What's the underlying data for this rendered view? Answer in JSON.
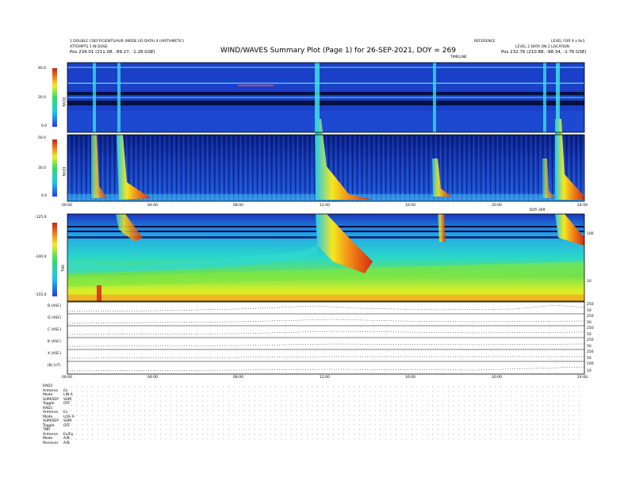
{
  "header": {
    "title": "WIND/WAVES Summary Plot (Page 1) for 26-SEP-2021, DOY = 269",
    "left_line1": "1 DOUBLE COEFFICIENTS/AUR (MODE I/O DATA) 4 (ARITHMETIC)",
    "left_line2": "ATTEMPTS 1 IN DOSE",
    "left_line3": "Pos   234.01 (211.08, -89.27, -1.28 GSE)",
    "right_line1": "REFERENCE",
    "right_line2": "LEVEL 2 DATA ON 2 LOCATION",
    "right_line3": "Pos   232.76 (210.88, -98.34, -1.76 GSE)",
    "right_top_small": "LEVEL FOR 9 x 9x1",
    "center_small": "TIMELINE"
  },
  "panels": {
    "rad2": {
      "label": "RAD2",
      "ticks": [
        "40.0",
        "20.0",
        "0.0"
      ]
    },
    "rad1": {
      "label": "RAD1",
      "ticks": [
        "50.0",
        "30.0",
        "0.0"
      ]
    },
    "tnr": {
      "label": "TNR",
      "ticks": [
        "-125.0",
        "-140.0",
        "-155.0"
      ],
      "right_ticks": [
        "100",
        "10"
      ]
    }
  },
  "time_ticks_a": [
    "00:00",
    "04:00",
    "08:00",
    "12:00",
    "16:00",
    "20:00",
    "24:00"
  ],
  "time_ticks_b": [
    "00:00",
    "04:00",
    "08:00",
    "12:00",
    "16:00",
    "20:00",
    "24:00"
  ],
  "mid_marker": "DOY 269",
  "line_panels": [
    {
      "label": "B (ASC)",
      "right_ticks": [
        "250",
        "50"
      ]
    },
    {
      "label": "Q (ASC)",
      "right_ticks": [
        "250",
        "50"
      ]
    },
    {
      "label": "C (ASC)",
      "right_ticks": [
        "250",
        "50"
      ]
    },
    {
      "label": "K (ASC)",
      "right_ticks": [
        "250",
        "50"
      ]
    },
    {
      "label": "X (ASC)",
      "right_ticks": [
        "250",
        "50"
      ]
    },
    {
      "label": "|B| (nT)",
      "right_ticks": [
        "100",
        "10"
      ]
    }
  ],
  "footer_rows": [
    [
      "RAD2",
      ""
    ],
    [
      "Antenna",
      "Ex"
    ],
    [
      "Mode",
      "LIN A"
    ],
    [
      "SUM/SEP",
      "SUM"
    ],
    [
      "Toggle",
      "OFF"
    ],
    [
      "RAD1",
      ""
    ],
    [
      "Antenna",
      "Ex"
    ],
    [
      "Mode",
      "LOG A"
    ],
    [
      "SUM/SEP",
      "SUM"
    ],
    [
      "Toggle",
      "OFF"
    ],
    [
      "TNR",
      ""
    ],
    [
      "Antenna",
      "Ex/Ey"
    ],
    [
      "Mode",
      "A/B"
    ],
    [
      "Receiver",
      "A/B"
    ]
  ],
  "colors": {
    "burst": "#d42a10",
    "background": "#1a3fc8"
  },
  "chart_data": [
    {
      "type": "heatmap",
      "title": "RAD2",
      "ylabel": "RAD2",
      "ylim": [
        0,
        40
      ],
      "xlim": [
        "00:00",
        "24:00"
      ],
      "bursts_hours": [
        1.7,
        2.6,
        11.7,
        17.6,
        22.5,
        23.5
      ]
    },
    {
      "type": "heatmap",
      "title": "RAD1",
      "ylabel": "RAD1",
      "ylim": [
        0,
        50
      ],
      "xlim": [
        "00:00",
        "24:00"
      ],
      "bursts_hours": [
        1.7,
        2.6,
        11.7,
        17.6,
        22.5,
        23.5
      ]
    },
    {
      "type": "heatmap",
      "title": "TNR",
      "ylabel": "TNR",
      "ylim": [
        -155,
        -125
      ],
      "xlim": [
        "00:00",
        "24:00"
      ],
      "bursts_hours": [
        1.7,
        2.6,
        11.7,
        17.6,
        22.5,
        23.5
      ]
    }
  ]
}
